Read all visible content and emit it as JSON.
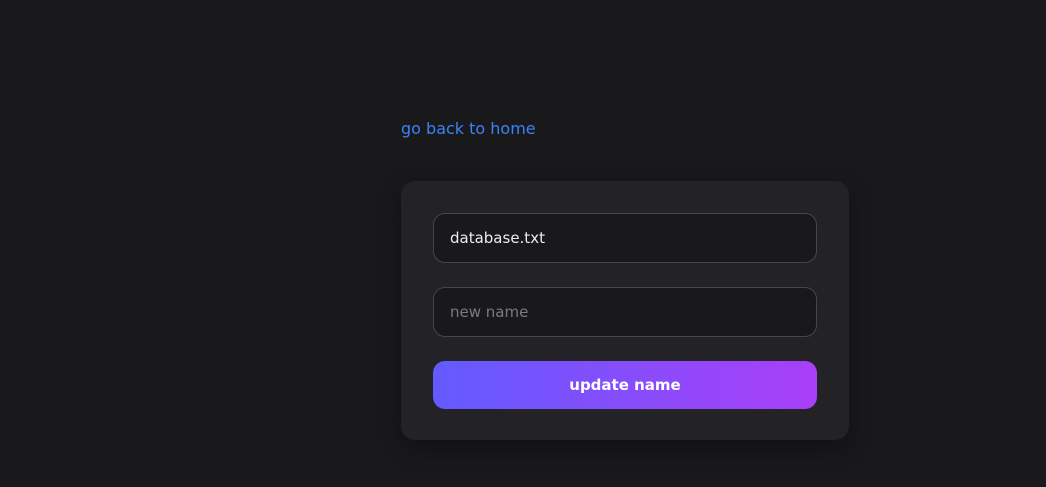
{
  "nav": {
    "back_link": "go back to home"
  },
  "form": {
    "current_name_value": "database.txt",
    "new_name_value": "",
    "new_name_placeholder": "new name",
    "submit_label": "update name"
  },
  "colors": {
    "background": "#19191b",
    "card": "#232226",
    "link": "#3b82f6",
    "button_gradient_start": "#635bff",
    "button_gradient_end": "#a93ff8"
  }
}
